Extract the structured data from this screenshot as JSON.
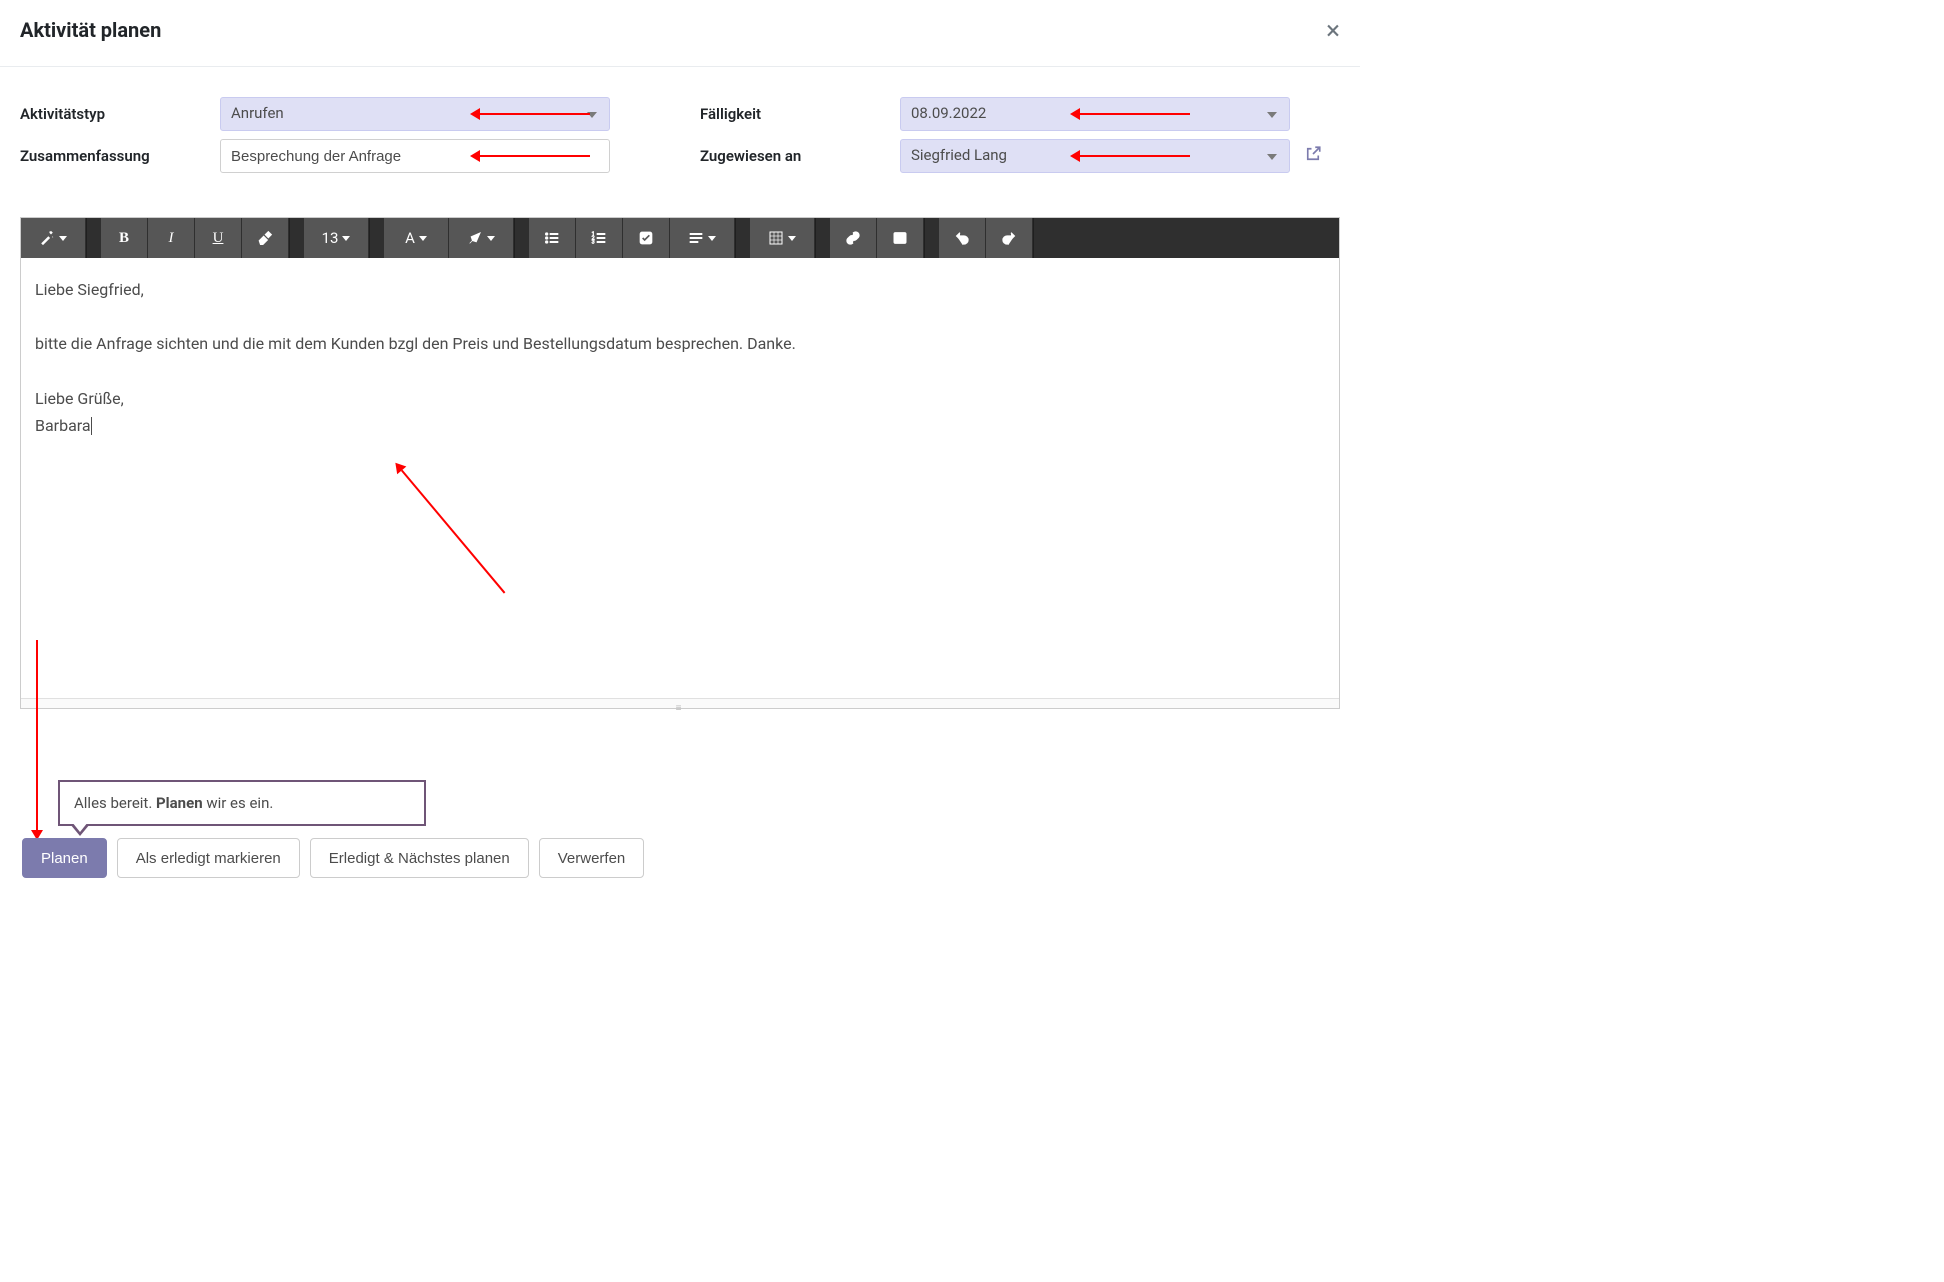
{
  "modal": {
    "title": "Aktivität planen"
  },
  "form": {
    "activity_type": {
      "label": "Aktivitätstyp",
      "value": "Anrufen"
    },
    "summary": {
      "label": "Zusammenfassung",
      "value": "Besprechung der Anfrage"
    },
    "due_date": {
      "label": "Fälligkeit",
      "value": "08.09.2022"
    },
    "assigned_to": {
      "label": "Zugewiesen an",
      "value": "Siegfried Lang"
    }
  },
  "toolbar": {
    "font_size": "13",
    "font_letter": "A"
  },
  "editor": {
    "line1": "Liebe Siegfried,",
    "line2": "bitte die Anfrage sichten und die mit dem Kunden bzgl den Preis und Bestellungsdatum besprechen. Danke.",
    "line3": "Liebe Grüße,",
    "line4": "Barbara"
  },
  "tooltip": {
    "pre": "Alles bereit. ",
    "bold": "Planen",
    "post": " wir es ein."
  },
  "buttons": {
    "plan": "Planen",
    "mark_done": "Als erledigt markieren",
    "done_next": "Erledigt & Nächstes planen",
    "discard": "Verwerfen"
  }
}
